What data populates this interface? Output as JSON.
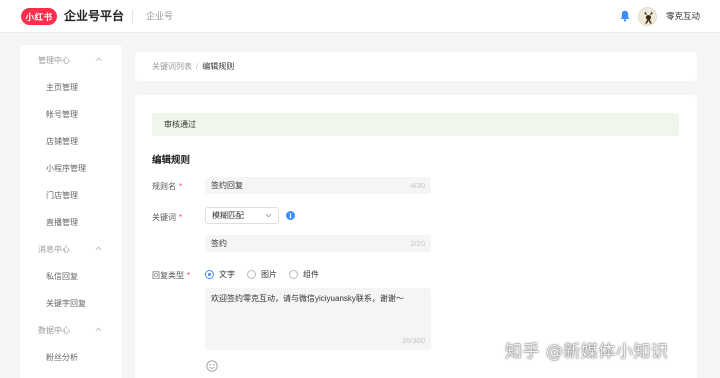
{
  "header": {
    "logo_text": "小红书",
    "title": "企业号平台",
    "nav_link": "企业号",
    "user_name": "零克互动"
  },
  "sidebar": {
    "groups": [
      {
        "label": "管理中心",
        "items": [
          "主页管理",
          "帐号管理",
          "店铺管理",
          "小程序管理",
          "门店管理",
          "直播管理"
        ]
      },
      {
        "label": "消息中心",
        "items": [
          "私信回复",
          "关键字回复"
        ]
      },
      {
        "label": "数据中心",
        "items": [
          "粉丝分析"
        ]
      }
    ]
  },
  "breadcrumb": {
    "prev": "关键词列表",
    "separator": "/",
    "current": "编辑规则"
  },
  "form": {
    "status_alert": "审核通过",
    "section_title": "编辑规则",
    "rule_name": {
      "label": "规则名",
      "value": "签约回复",
      "count": "4/30"
    },
    "keyword": {
      "label": "关键词",
      "match_mode": "模糊匹配",
      "info_glyph": "i",
      "value": "签约",
      "count": "2/20"
    },
    "reply_type": {
      "label": "回复类型",
      "options": [
        "文字",
        "图片",
        "组件"
      ],
      "selected": "文字"
    },
    "reply_text": {
      "value": "欢迎签约零克互动，请与微信yiciyuansky联系，谢谢～",
      "count": "35/300"
    },
    "required_mark": "*"
  },
  "watermark": "知乎 @新媒体小知识",
  "colors": {
    "brand_red": "#ff2e4d",
    "primary_blue": "#3e8ef7",
    "success_bg": "#eef7ea"
  }
}
